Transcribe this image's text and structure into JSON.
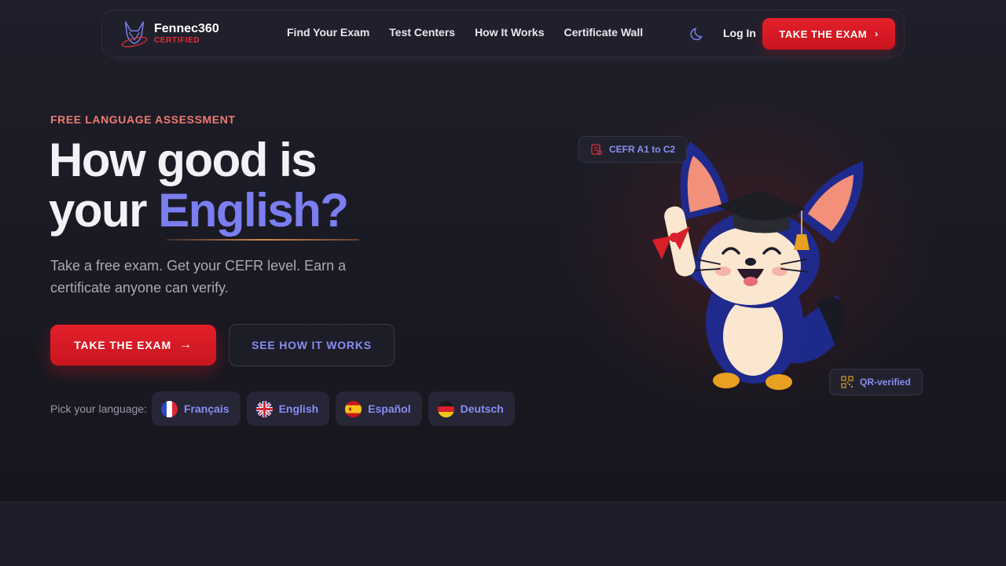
{
  "nav": {
    "brand_name": "Fennec360",
    "brand_sub": "CERTIFIED",
    "links": [
      "Find Your Exam",
      "Test Centers",
      "How It Works",
      "Certificate Wall"
    ],
    "login": "Log In",
    "cta": "TAKE THE EXAM",
    "cta_icon": "chevron-right-icon",
    "theme_icon": "moon-icon"
  },
  "hero": {
    "eyebrow": "FREE LANGUAGE ASSESSMENT",
    "headline_line1": "How good is",
    "headline_line2_prefix": "your ",
    "headline_accent": "English?",
    "subtext": "Take a free exam. Get your CEFR level. Earn a certificate anyone can verify.",
    "cta_primary": "TAKE THE EXAM",
    "cta_secondary": "SEE HOW IT WORKS",
    "language_label": "Pick your language:",
    "languages": [
      {
        "label": "Français",
        "flag": "fr-flag-icon"
      },
      {
        "label": "English",
        "flag": "uk-flag-icon"
      },
      {
        "label": "Español",
        "flag": "es-flag-icon"
      },
      {
        "label": "Deutsch",
        "flag": "de-flag-icon"
      }
    ]
  },
  "badges": {
    "cefr": "CEFR A1 to C2",
    "qr": "QR-verified"
  },
  "colors": {
    "accent_red": "#e3202a",
    "accent_indigo": "#7b7ef0",
    "background": "#1b1b26"
  }
}
